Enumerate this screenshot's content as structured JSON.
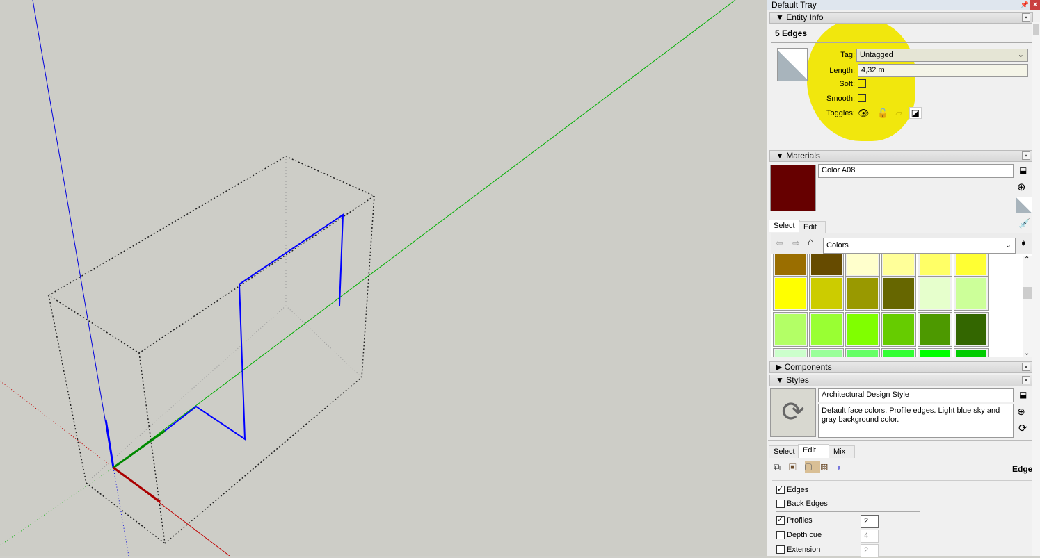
{
  "tray": {
    "title": "Default Tray",
    "pin_icon": "pin-icon",
    "close_icon": "close-icon"
  },
  "entity_info": {
    "header": "Entity Info",
    "selection": "5 Edges",
    "tag_label": "Tag:",
    "tag_value": "Untagged",
    "length_label": "Length:",
    "length_value": "4,32 m",
    "soft_label": "Soft:",
    "soft_checked": false,
    "smooth_label": "Smooth:",
    "smooth_checked": false,
    "toggles_label": "Toggles:",
    "toggles": [
      "eye-icon",
      "lock-icon",
      "receive-shadows-icon",
      "cast-shadows-icon"
    ],
    "highlight_color": "#f0e600"
  },
  "materials": {
    "header": "Materials",
    "name": "Color A08",
    "current_color": "#660000",
    "tabs": [
      "Select",
      "Edit"
    ],
    "active_tab": "Select",
    "collection": "Colors",
    "swatches": [
      [
        "#9a6e00",
        "#664b00",
        "#ffffcc",
        "#ffff99",
        "#ffff66",
        "#ffff33"
      ],
      [
        "#ffff00",
        "#cccc00",
        "#999900",
        "#666600",
        "#e6ffcc",
        "#ccff99"
      ],
      [
        "#b3ff66",
        "#99ff33",
        "#80ff00",
        "#66cc00",
        "#4d9900",
        "#336600"
      ],
      [
        "#ccffcc",
        "#99ff99",
        "#66ff66",
        "#33ff33",
        "#00ff00",
        "#00cc00"
      ]
    ]
  },
  "components": {
    "header": "Components"
  },
  "styles": {
    "header": "Styles",
    "name": "Architectural Design Style",
    "description": "Default face colors. Profile edges. Light blue sky and gray background color.",
    "tabs": [
      "Select",
      "Edit",
      "Mix"
    ],
    "active_tab": "Edit",
    "section": "Edge",
    "options": [
      {
        "label": "Edges",
        "checked": true
      },
      {
        "label": "Back Edges",
        "checked": false
      },
      {
        "label": "Profiles",
        "checked": true,
        "value": "2"
      },
      {
        "label": "Depth cue",
        "checked": false,
        "value": "4"
      },
      {
        "label": "Extension",
        "checked": false,
        "value": "2"
      }
    ]
  },
  "scene": {
    "axis_colors": {
      "red": "#c00000",
      "green": "#00b000",
      "blue": "#0000dd"
    },
    "selection_color": "#0000ff"
  }
}
